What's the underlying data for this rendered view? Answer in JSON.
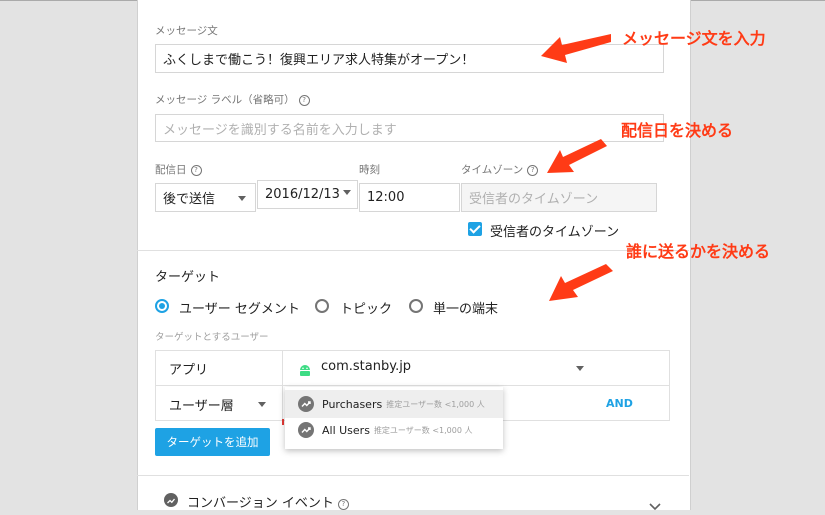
{
  "message": {
    "label": "メッセージ文",
    "value": "ふくしまで働こう！復興エリア求人特集がオープン！"
  },
  "message_label": {
    "label": "メッセージ ラベル（省略可）",
    "placeholder": "メッセージを識別する名前を入力します"
  },
  "schedule": {
    "delivery_date_label": "配信日",
    "send_option": "後で送信",
    "date": "2016/12/13",
    "time_label": "時刻",
    "time": "12:00",
    "timezone_label": "タイムゾーン",
    "timezone_placeholder": "受信者のタイムゾーン",
    "recipient_timezone_checkbox": "受信者のタイムゾーン",
    "recipient_timezone_checked": true
  },
  "target": {
    "title": "ターゲット",
    "options": [
      {
        "label": "ユーザー セグメント",
        "selected": true
      },
      {
        "label": "トピック",
        "selected": false
      },
      {
        "label": "単一の端末",
        "selected": false
      }
    ],
    "target_users_label": "ターゲットとするユーザー",
    "app_label": "アプリ",
    "app_value": "com.stanby.jp",
    "user_layer_label": "ユーザー層",
    "and_label": "AND",
    "add_target_button": "ターゲットを追加",
    "dropdown_items": [
      {
        "name": "Purchasers",
        "meta": "推定ユーザー数 <1,000 人"
      },
      {
        "name": "All Users",
        "meta": "推定ユーザー数 <1,000 人"
      }
    ]
  },
  "conversion": {
    "label": "コンバージョン イベント"
  },
  "annotations": {
    "enter_message": "メッセージ文を入力",
    "decide_date": "配信日を決める",
    "decide_target": "誰に送るかを決める"
  },
  "colors": {
    "accent": "#1ea2e4",
    "annotation": "#ff3b16",
    "android": "#3ddc84"
  }
}
